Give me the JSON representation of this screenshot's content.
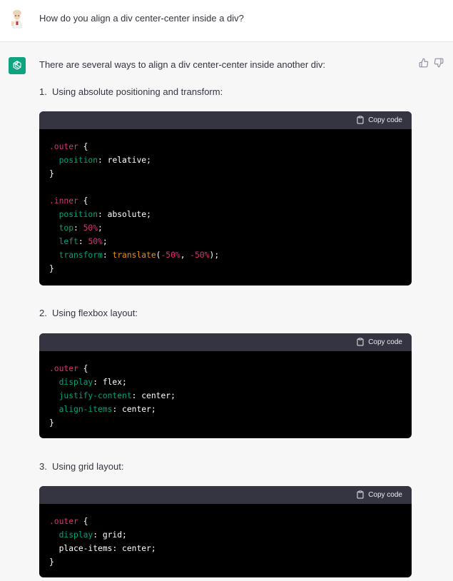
{
  "user": {
    "question": "How do you align a div center-center inside a div?"
  },
  "assistant": {
    "intro": "There are several ways to align a div center-center inside another div:",
    "copy_label": "Copy code",
    "items": [
      {
        "number": "1.",
        "text": "Using absolute positioning and transform:"
      },
      {
        "number": "2.",
        "text": "Using flexbox layout:"
      },
      {
        "number": "3.",
        "text": "Using grid layout:"
      }
    ],
    "code1": {
      "l1_sel": ".outer",
      "l1_brace": " {",
      "l2_prop": "position",
      "l2_val": "relative",
      "l3": "}",
      "l5_sel": ".inner",
      "l5_brace": " {",
      "l6_prop": "position",
      "l6_val": "absolute",
      "l7_prop": "top",
      "l7_val": "50%",
      "l8_prop": "left",
      "l8_val": "50%",
      "l9_prop": "transform",
      "l9_fn": "translate",
      "l9_a": "-50%",
      "l9_b": "-50%",
      "l10": "}"
    },
    "code2": {
      "l1_sel": ".outer",
      "l1_brace": " {",
      "l2_prop": "display",
      "l2_val": "flex",
      "l3_prop": "justify-content",
      "l3_val": "center",
      "l4_prop": "align-items",
      "l4_val": "center",
      "l5": "}"
    },
    "code3": {
      "l1_sel": ".outer",
      "l1_brace": " {",
      "l2_prop": "display",
      "l2_val": "grid",
      "l3_prop": "place-items",
      "l3_val": "center",
      "l4": "}"
    }
  },
  "colors": {
    "accent": "#10a37f",
    "code_header": "#343541",
    "selector": "#df3079",
    "property": "#00a67d"
  }
}
